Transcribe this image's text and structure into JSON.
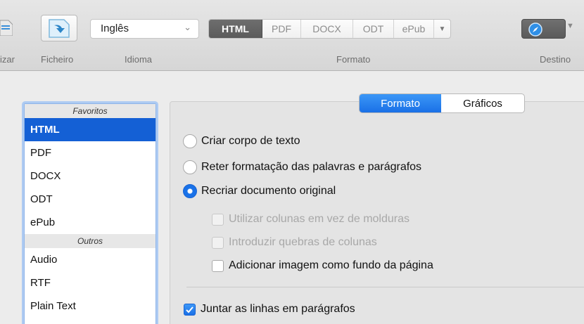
{
  "toolbar": {
    "partial_label": "izar",
    "file_label": "Ficheiro",
    "language_label": "Idioma",
    "language_value": "Inglês",
    "format_label": "Formato",
    "formats": [
      "HTML",
      "PDF",
      "DOCX",
      "ODT",
      "ePub"
    ],
    "active_format": "HTML",
    "destination_label": "Destino"
  },
  "sidebar": {
    "favorites_header": "Favoritos",
    "favorites": [
      "HTML",
      "PDF",
      "DOCX",
      "ODT",
      "ePub"
    ],
    "others_header": "Outros",
    "others": [
      "Audio",
      "RTF",
      "Plain Text"
    ],
    "selected": "HTML"
  },
  "tabs": {
    "format": "Formato",
    "graphics": "Gráficos",
    "active": "Formato"
  },
  "options": {
    "radio_1": "Criar corpo de texto",
    "radio_2": "Reter formatação das palavras e parágrafos",
    "radio_3": "Recriar documento original",
    "check_1": "Utilizar colunas em vez de molduras",
    "check_2": "Introduzir quebras de colunas",
    "check_3": "Adicionar imagem como fundo da página",
    "check_4": "Juntar as linhas em parágrafos"
  },
  "colors": {
    "accent": "#1a72e8",
    "selection": "#1460d5"
  }
}
